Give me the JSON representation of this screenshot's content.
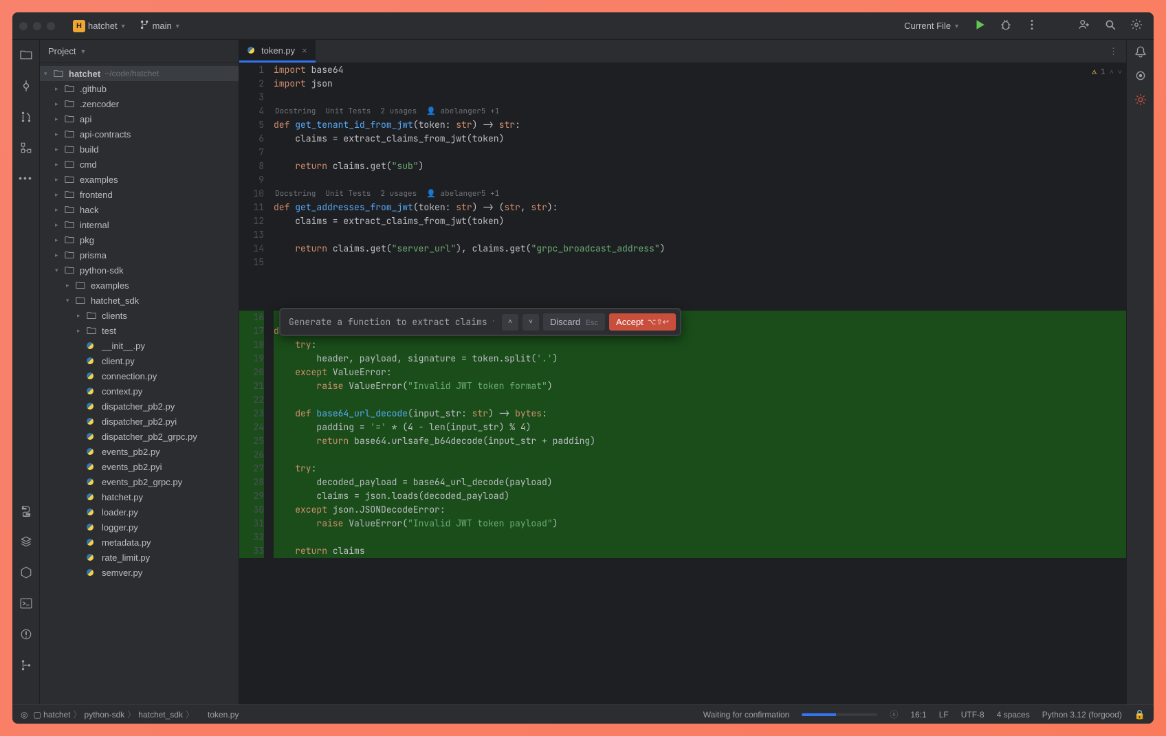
{
  "titlebar": {
    "project_name": "hatchet",
    "project_badge": "H",
    "branch_icon": "branch",
    "branch": "main",
    "run_config": "Current File"
  },
  "sidebar": {
    "title": "Project",
    "root_name": "hatchet",
    "root_path": "~/code/hatchet",
    "tree": [
      {
        "label": ".github",
        "depth": 1,
        "type": "folder",
        "expanded": false
      },
      {
        "label": ".zencoder",
        "depth": 1,
        "type": "folder",
        "expanded": false
      },
      {
        "label": "api",
        "depth": 1,
        "type": "folder",
        "expanded": false
      },
      {
        "label": "api-contracts",
        "depth": 1,
        "type": "folder",
        "expanded": false
      },
      {
        "label": "build",
        "depth": 1,
        "type": "folder",
        "expanded": false
      },
      {
        "label": "cmd",
        "depth": 1,
        "type": "folder",
        "expanded": false
      },
      {
        "label": "examples",
        "depth": 1,
        "type": "folder",
        "expanded": false
      },
      {
        "label": "frontend",
        "depth": 1,
        "type": "folder",
        "expanded": false
      },
      {
        "label": "hack",
        "depth": 1,
        "type": "folder",
        "expanded": false
      },
      {
        "label": "internal",
        "depth": 1,
        "type": "folder",
        "expanded": false
      },
      {
        "label": "pkg",
        "depth": 1,
        "type": "folder",
        "expanded": false
      },
      {
        "label": "prisma",
        "depth": 1,
        "type": "folder",
        "expanded": false
      },
      {
        "label": "python-sdk",
        "depth": 1,
        "type": "folder",
        "expanded": true
      },
      {
        "label": "examples",
        "depth": 2,
        "type": "folder",
        "expanded": false
      },
      {
        "label": "hatchet_sdk",
        "depth": 2,
        "type": "folder",
        "expanded": true
      },
      {
        "label": "clients",
        "depth": 3,
        "type": "folder",
        "expanded": false
      },
      {
        "label": "test",
        "depth": 3,
        "type": "folder",
        "expanded": false
      },
      {
        "label": "__init__.py",
        "depth": 3,
        "type": "py"
      },
      {
        "label": "client.py",
        "depth": 3,
        "type": "py"
      },
      {
        "label": "connection.py",
        "depth": 3,
        "type": "py"
      },
      {
        "label": "context.py",
        "depth": 3,
        "type": "py"
      },
      {
        "label": "dispatcher_pb2.py",
        "depth": 3,
        "type": "py"
      },
      {
        "label": "dispatcher_pb2.pyi",
        "depth": 3,
        "type": "py"
      },
      {
        "label": "dispatcher_pb2_grpc.py",
        "depth": 3,
        "type": "py"
      },
      {
        "label": "events_pb2.py",
        "depth": 3,
        "type": "py"
      },
      {
        "label": "events_pb2.pyi",
        "depth": 3,
        "type": "py"
      },
      {
        "label": "events_pb2_grpc.py",
        "depth": 3,
        "type": "py"
      },
      {
        "label": "hatchet.py",
        "depth": 3,
        "type": "py"
      },
      {
        "label": "loader.py",
        "depth": 3,
        "type": "py"
      },
      {
        "label": "logger.py",
        "depth": 3,
        "type": "py"
      },
      {
        "label": "metadata.py",
        "depth": 3,
        "type": "py"
      },
      {
        "label": "rate_limit.py",
        "depth": 3,
        "type": "py"
      },
      {
        "label": "semver.py",
        "depth": 3,
        "type": "py"
      }
    ]
  },
  "tabs": [
    {
      "label": "token.py"
    }
  ],
  "editor": {
    "inspection": {
      "warn_count": "1"
    },
    "hints": {
      "docstring": "Docstring",
      "unit_tests": "Unit Tests",
      "usages": "2 usages",
      "author": "abelanger5 +1"
    },
    "lines": [
      {
        "n": "1",
        "html": "<span class='k'>import</span> base64"
      },
      {
        "n": "2",
        "html": "<span class='k'>import</span> json"
      },
      {
        "n": "3",
        "html": ""
      },
      {
        "n": "4",
        "html": "",
        "hint": true
      },
      {
        "n": "5",
        "html": "<span class='k'>def</span> <span class='fn'>get_tenant_id_from_jwt</span>(token: <span class='k'>str</span>) -> <span class='k'>str</span>:"
      },
      {
        "n": "6",
        "html": "    claims = extract_claims_from_jwt(token)"
      },
      {
        "n": "7",
        "html": ""
      },
      {
        "n": "8",
        "html": "    <span class='k'>return</span> claims.get(<span class='str'>\"sub\"</span>)"
      },
      {
        "n": "9",
        "html": ""
      },
      {
        "n": "10",
        "html": "",
        "hint": true
      },
      {
        "n": "11",
        "html": "<span class='k'>def</span> <span class='fn'>get_addresses_from_jwt</span>(token: <span class='k'>str</span>) -> (<span class='k'>str</span>, <span class='k'>str</span>):"
      },
      {
        "n": "12",
        "html": "    claims = extract_claims_from_jwt(token)"
      },
      {
        "n": "13",
        "html": ""
      },
      {
        "n": "14",
        "html": "    <span class='k'>return</span> claims.get(<span class='str'>\"server_url\"</span>), claims.get(<span class='str'>\"grpc_broadcast_address\"</span>)"
      },
      {
        "n": "15",
        "html": ""
      }
    ],
    "gen_start": "16",
    "gen_lines": [
      {
        "n": "16",
        "html": ""
      },
      {
        "n": "17",
        "html": "<span class='k'>def</span> <span class='fn'>extract_claims_from_jwt</span>(token: <span class='k'>str</span>) -> <span class='k'>dict</span>:"
      },
      {
        "n": "18",
        "html": "    <span class='k'>try</span>:"
      },
      {
        "n": "19",
        "html": "        header, payload, signature = token.split(<span class='str'>'.'</span>)"
      },
      {
        "n": "20",
        "html": "    <span class='k'>except</span> ValueError:"
      },
      {
        "n": "21",
        "html": "        <span class='k'>raise</span> ValueError(<span class='str'>\"Invalid JWT token format\"</span>)"
      },
      {
        "n": "22",
        "html": ""
      },
      {
        "n": "23",
        "html": "    <span class='k'>def</span> <span class='fn'>base64_url_decode</span>(input_str: <span class='k'>str</span>) -> <span class='k'>bytes</span>:"
      },
      {
        "n": "24",
        "html": "        padding = <span class='str'>'='</span> * (4 - len(input_str) % 4)"
      },
      {
        "n": "25",
        "html": "        <span class='k'>return</span> base64.urlsafe_b64decode(input_str + padding)"
      },
      {
        "n": "26",
        "html": ""
      },
      {
        "n": "27",
        "html": "    <span class='k'>try</span>:"
      },
      {
        "n": "28",
        "html": "        decoded_payload = base64_url_decode(payload)"
      },
      {
        "n": "29",
        "html": "        claims = json.loads(decoded_payload)"
      },
      {
        "n": "30",
        "html": "    <span class='k'>except</span> json.JSONDecodeError:"
      },
      {
        "n": "31",
        "html": "        <span class='k'>raise</span> ValueError(<span class='str'>\"Invalid JWT token payload\"</span>)"
      },
      {
        "n": "32",
        "html": ""
      },
      {
        "n": "33",
        "html": "    <span class='k'>return</span> claims"
      }
    ]
  },
  "ai_bar": {
    "prompt": "Generate a function to extract claims fro",
    "discard": "Discard",
    "discard_kb": "Esc",
    "accept": "Accept",
    "accept_kb": "⌥⇧↩"
  },
  "statusbar": {
    "crumbs": [
      "hatchet",
      "python-sdk",
      "hatchet_sdk",
      "token.py"
    ],
    "task": "Waiting for confirmation",
    "pos": "16:1",
    "enc_sep": "LF",
    "enc": "UTF-8",
    "indent": "4 spaces",
    "interpreter": "Python 3.12 (forgood)"
  }
}
